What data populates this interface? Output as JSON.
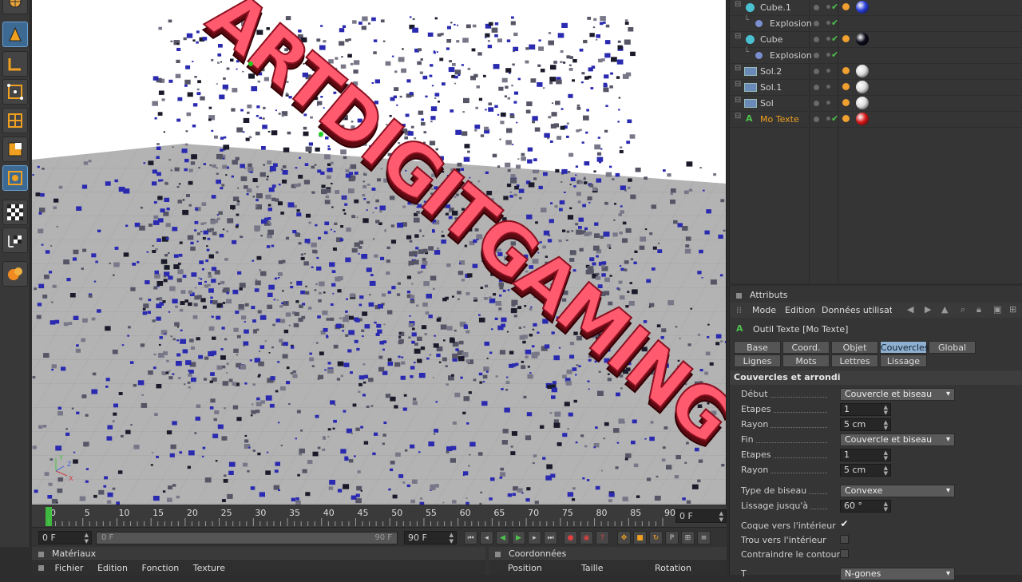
{
  "objects": [
    {
      "name": "Cube.1",
      "ball": "#2a3fd8",
      "child": false,
      "check": true
    },
    {
      "name": "Explosion",
      "child": true,
      "check": true
    },
    {
      "name": "Cube",
      "ball": "#0a0a1a",
      "child": false,
      "check": true
    },
    {
      "name": "Explosion",
      "child": true,
      "check": true
    },
    {
      "name": "Sol.2",
      "ball": "#dcdcdc",
      "child": false,
      "check": false
    },
    {
      "name": "Sol.1",
      "ball": "#dcdcdc",
      "child": false,
      "check": false
    },
    {
      "name": "Sol",
      "ball": "#dcdcdc",
      "child": false,
      "check": false
    },
    {
      "name": "Mo Texte",
      "ball": "#d81818",
      "child": false,
      "check": true,
      "highlight": true
    }
  ],
  "attributes": {
    "title": "Attributs",
    "menu": [
      "Mode",
      "Edition",
      "Données utilisateur"
    ],
    "tool_title": "Outil Texte [Mo Texte]",
    "tabs_row1": [
      "Base",
      "Coord.",
      "Objet",
      "Couvercles",
      "Global"
    ],
    "tabs_row2": [
      "Lignes",
      "Mots",
      "Lettres",
      "Lissage"
    ],
    "active_tab": "Couvercles",
    "section": "Couvercles et arrondi",
    "debut_label": "Début",
    "debut_value": "Couvercle et biseau",
    "etapes1_label": "Etapes",
    "etapes1_value": "1",
    "rayon1_label": "Rayon",
    "rayon1_value": "5 cm",
    "fin_label": "Fin",
    "fin_value": "Couvercle et biseau",
    "etapes2_label": "Etapes",
    "etapes2_value": "1",
    "rayon2_label": "Rayon",
    "rayon2_value": "5 cm",
    "type_label": "Type de biseau",
    "type_value": "Convexe",
    "lissage_label": "Lissage jusqu'à",
    "lissage_value": "60 °",
    "coque_label": "Coque vers l'intérieur",
    "trou_label": "Trou vers l'intérieur",
    "contraindre_label": "Contraindre le contour",
    "partial_label": "T",
    "partial_value": "N-gones"
  },
  "timeline": {
    "ticks": [
      "0",
      "5",
      "10",
      "15",
      "20",
      "25",
      "30",
      "35",
      "40",
      "45",
      "50",
      "55",
      "60",
      "65",
      "70",
      "75",
      "80",
      "85",
      "90"
    ],
    "frame_field": "0 F",
    "start_field": "0 F",
    "range_start": "0 F",
    "range_end": "90 F",
    "end_field": "90 F",
    "current": 0
  },
  "bottom": {
    "materials_title": "Matériaux",
    "materials_menu": [
      "Fichier",
      "Edition",
      "Fonction",
      "Texture"
    ],
    "coords_title": "Coordonnées",
    "coords_headers": [
      "Position",
      "Taille",
      "Rotation"
    ]
  },
  "viewport": {
    "text": "ARTDIGITGAMING",
    "text_color": "#ff5a6e",
    "particle_color": "#2a2aa8"
  }
}
